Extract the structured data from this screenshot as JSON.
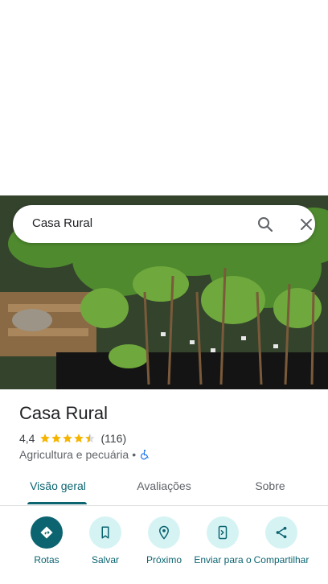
{
  "search": {
    "query": "Casa Rural"
  },
  "place": {
    "name": "Casa Rural",
    "rating": "4,4",
    "rating_value": 4.4,
    "review_count": "(116)",
    "category": "Agricultura e pecuária",
    "separator": "•"
  },
  "tabs": [
    {
      "label": "Visão geral",
      "active": true
    },
    {
      "label": "Avaliações",
      "active": false
    },
    {
      "label": "Sobre",
      "active": false
    }
  ],
  "actions": [
    {
      "label": "Rotas",
      "icon": "directions-icon"
    },
    {
      "label": "Salvar",
      "icon": "bookmark-icon"
    },
    {
      "label": "Próximo",
      "icon": "nearby-icon"
    },
    {
      "label": "Enviar para o",
      "icon": "send-to-phone-icon"
    },
    {
      "label": "Compartilhar",
      "icon": "share-icon"
    }
  ],
  "colors": {
    "accent": "#0b6470",
    "accent_light": "#d6f3f4",
    "star": "#f5b400",
    "accessibility": "#1a73e8"
  }
}
